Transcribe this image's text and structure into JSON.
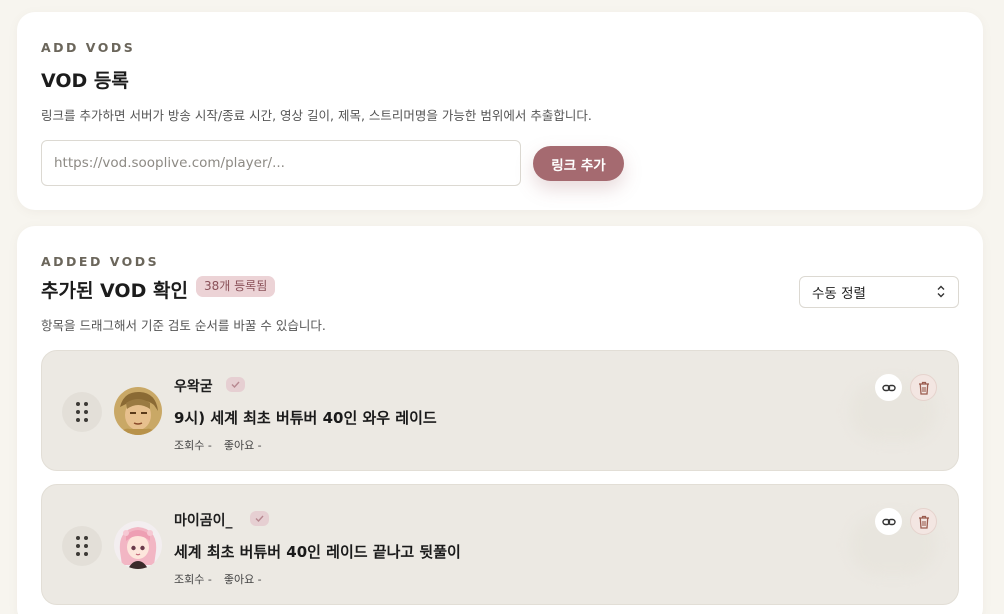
{
  "add_section": {
    "eyebrow": "ADD VODS",
    "title": "VOD 등록",
    "description": "링크를 추가하면 서버가 방송 시작/종료 시간, 영상 길이, 제목, 스트리머명을 가능한 범위에서 추출합니다.",
    "input_placeholder": "https://vod.sooplive.com/player/...",
    "input_value": "",
    "add_button_label": "링크 추가"
  },
  "list_section": {
    "eyebrow": "ADDED VODS",
    "title": "추가된 VOD 확인",
    "count_badge": "38개 등록됨",
    "description": "항목을 드래그해서 기준 검토 순서를 바꿀 수 있습니다.",
    "sort_selected": "수동 정렬",
    "items": [
      {
        "streamer": "우왁굳",
        "title": "9시) 세계 최초 버튜버 40인 와우 레이드",
        "views": "조회수 -",
        "likes": "좋아요 -"
      },
      {
        "streamer": "마이곰이_",
        "title": "세계 최초 버튜버 40인 레이드 끝나고 뒷풀이",
        "views": "조회수 -",
        "likes": "좋아요 -"
      }
    ]
  },
  "icons": {
    "drag": "drag-handle-icon",
    "verified": "check-icon",
    "link": "link-icon",
    "delete": "trash-icon",
    "sort": "chevron-updown-icon"
  },
  "colors": {
    "background": "#f7f5ef",
    "accent": "#a56a70",
    "badge_bg": "#ecd3d6",
    "item_bg": "#ece9e3"
  }
}
